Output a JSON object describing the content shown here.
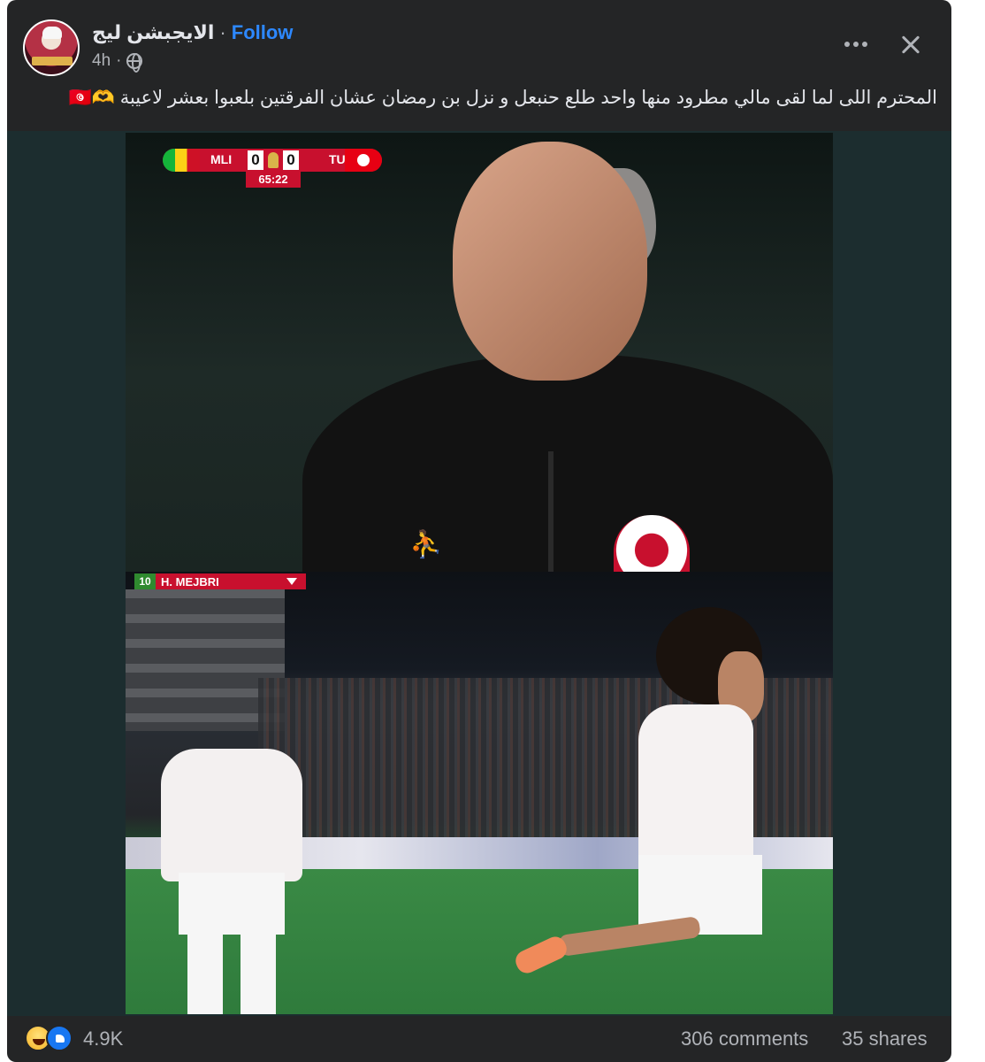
{
  "post": {
    "page_name": "الايجبشن ليج",
    "separator": "·",
    "follow_label": "Follow",
    "time_ago": "4h",
    "privacy_icon": "globe-icon",
    "caption": "المحترم اللى لما لقى مالي مطرود منها واحد طلع حنبعل و نزل بن رمضان عشان الفرقتين بلعبوا بعشر لاعيبة 🫶🇹🇳"
  },
  "header_actions": {
    "more_icon": "more-dots-icon",
    "close_icon": "close-icon"
  },
  "scoreboard": {
    "home_team": "MLI",
    "home_score": "0",
    "away_team": "TUN",
    "away_score": "0",
    "match_time": "65:22"
  },
  "player_graphic": {
    "number": "10",
    "name": "H. MEJBRI"
  },
  "footer": {
    "reaction_icons": [
      "haha-icon",
      "like-icon"
    ],
    "reaction_count": "4.9K",
    "comments": "306 comments",
    "shares": "35 shares"
  },
  "colors": {
    "background": "#242526",
    "follow": "#2d88ff",
    "secondary_text": "#b0b3b8",
    "primary_text": "#e4e6eb",
    "broadcast_red": "#c8102e"
  }
}
